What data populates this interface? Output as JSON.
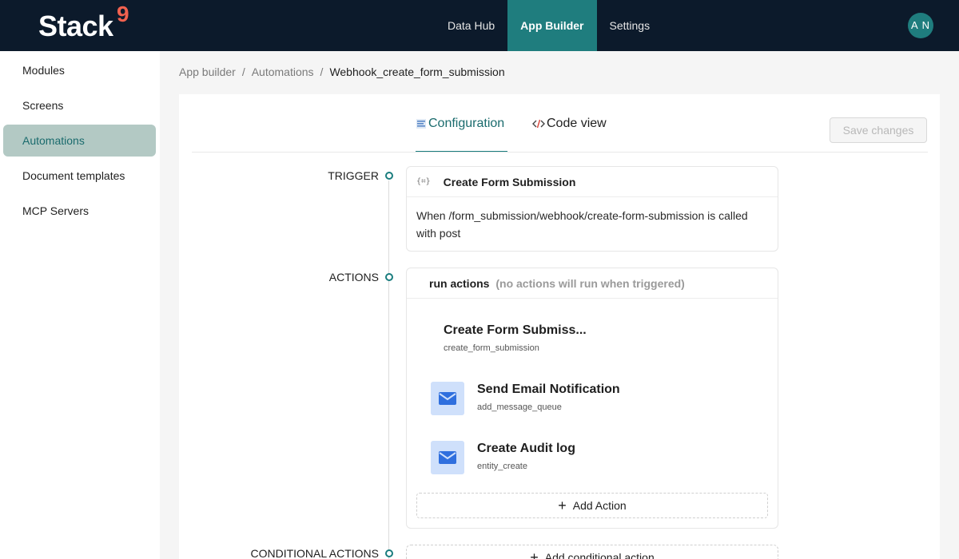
{
  "brand": {
    "name": "Stack",
    "mark": "9",
    "accent": "#f0614f"
  },
  "nav": {
    "items": [
      {
        "label": "Data Hub"
      },
      {
        "label": "App Builder",
        "active": true
      },
      {
        "label": "Settings"
      }
    ]
  },
  "user": {
    "initials": "A N"
  },
  "sidebar": {
    "items": [
      {
        "label": "Modules"
      },
      {
        "label": "Screens"
      },
      {
        "label": "Automations",
        "active": true
      },
      {
        "label": "Document templates"
      },
      {
        "label": "MCP Servers"
      }
    ]
  },
  "breadcrumb": {
    "items": [
      "App builder",
      "Automations"
    ],
    "current": "Webhook_create_form_submission"
  },
  "tabs": {
    "configuration": {
      "label": "Configuration",
      "icon": "configuration-icon"
    },
    "code": {
      "label": "Code view",
      "icon": "code-icon"
    }
  },
  "save": {
    "label": "Save changes"
  },
  "trigger": {
    "section_label": "TRIGGER",
    "title": "Create Form Submission",
    "description": "When /form_submission/webhook/create-form-submission is called with post"
  },
  "actions": {
    "section_label": "ACTIONS",
    "heading": "run actions",
    "note": "(no actions will run when triggered)",
    "items": [
      {
        "title": "Create Form Submiss...",
        "sub": "create_form_submission"
      },
      {
        "title": "Send Email Notification",
        "sub": "add_message_queue",
        "icon": "mail-icon"
      },
      {
        "title": "Create Audit log",
        "sub": "entity_create",
        "icon": "mail-icon"
      }
    ],
    "add_label": "Add Action"
  },
  "conditional": {
    "section_label": "CONDITIONAL ACTIONS",
    "add_label": "Add conditional action"
  }
}
